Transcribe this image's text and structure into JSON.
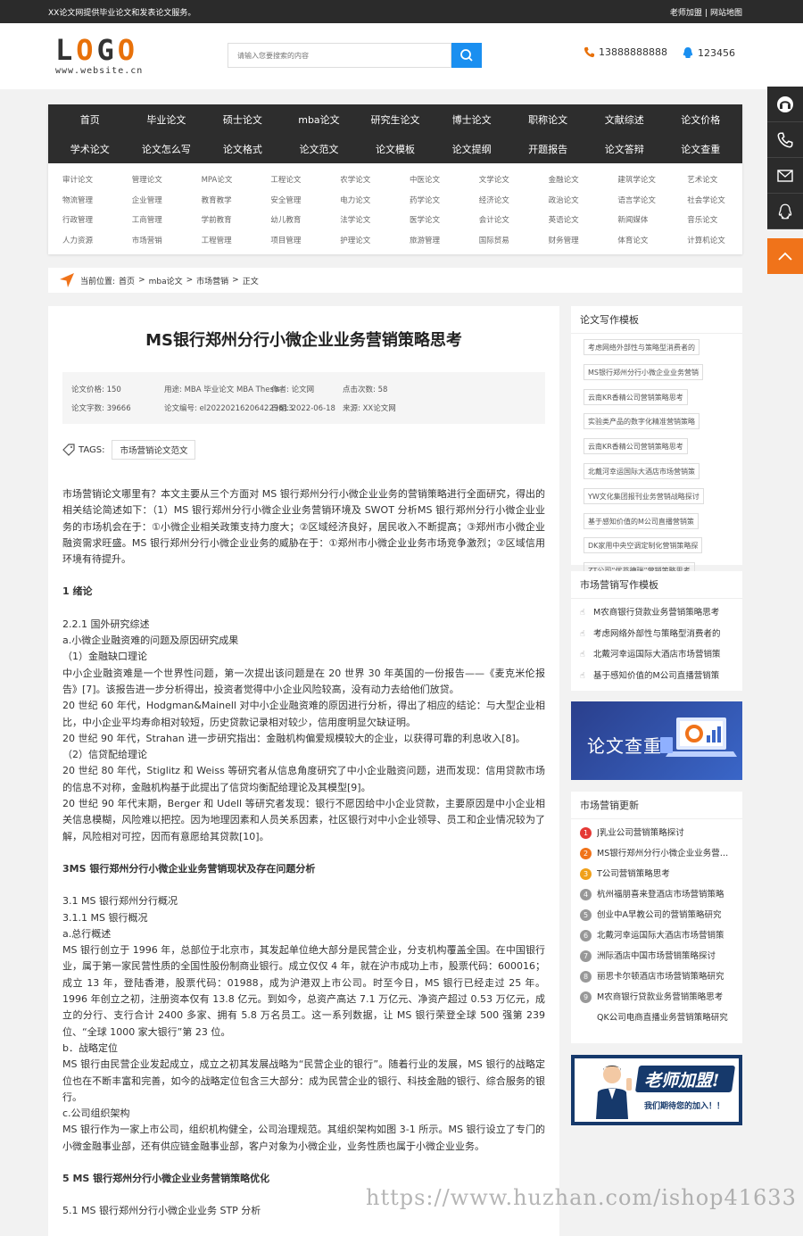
{
  "topbar": {
    "left": "XX论文网提供毕业论文和发表论文服务。",
    "right1": "老师加盟",
    "sep": "|",
    "right2": "网站地图"
  },
  "logo": {
    "text": "LOGO",
    "site": "www.website.cn"
  },
  "search": {
    "placeholder": "请输入您要搜索的内容"
  },
  "contact": {
    "phone": "13888888888",
    "qq": "123456"
  },
  "nav": {
    "row1": [
      "首页",
      "毕业论文",
      "硕士论文",
      "mba论文",
      "研究生论文",
      "博士论文",
      "职称论文",
      "文献综述",
      "论文价格"
    ],
    "row2": [
      "学术论文",
      "论文怎么写",
      "论文格式",
      "论文范文",
      "论文模板",
      "论文提纲",
      "开题报告",
      "论文答辩",
      "论文查重"
    ],
    "sub": [
      [
        "审计论文",
        "管理论文",
        "物流管理",
        "企业管理",
        "行政管理",
        "工商管理",
        "人力资源",
        "市场营销"
      ],
      [
        "MPA论文",
        "工程论文",
        "教育教学",
        "安全管理",
        "学前教育",
        "幼儿教育",
        "工程管理",
        "项目管理"
      ],
      [
        "农学论文",
        "中医论文",
        "电力论文",
        "药学论文",
        "法学论文",
        "医学论文",
        "护理论文",
        "旅游管理"
      ],
      [
        "文学论文",
        "金融论文",
        "经济论文",
        "政治论文",
        "会计论文",
        "英语论文",
        "国际贸易",
        "财务管理"
      ],
      [
        "建筑学论文",
        "艺术论文",
        "语言学论文",
        "社会学论文",
        "新闻媒体",
        "音乐论文",
        "体育论文",
        "计算机论文"
      ]
    ]
  },
  "breadcrumb": {
    "label": "当前位置:",
    "home": "首页",
    "cat": "mba论文",
    "sub": "市场营销",
    "cur": "正文",
    "sep": ">"
  },
  "article": {
    "title": "MS银行郑州分行小微企业业务营销策略思考",
    "meta": [
      "论文价格: 150",
      "用途: MBA 毕业论文 MBA Thesis",
      "作者: 论文网",
      "点击次数: 58",
      "论文字数: 39666",
      "论文编号: el202202162064229613",
      "日期: 2022-06-18",
      "来源: XX论文网"
    ],
    "tags_label": "TAGS:",
    "tag": "市场营销论文范文",
    "abstract": "市场营销论文哪里有？本文主要从三个方面对 MS 银行郑州分行小微企业业务的营销策略进行全面研究，得出的相关结论简述如下：（1）MS 银行郑州分行小微企业业务营销环境及 SWOT 分析MS 银行郑州分行小微企业业务的市场机会在于：①小微企业相关政策支持力度大；②区域经济良好，居民收入不断提高；③郑州市小微企业融资需求旺盛。MS 银行郑州分行小微企业业务的威胁在于：①郑州市小微企业业务市场竞争激烈；②区域信用环境有待提升。",
    "h1": "1 绪论",
    "s221": "2.2.1 国外研究综述",
    "sa": "a.小微企业融资难的问题及原因研究成果",
    "s1": "（1）金融缺口理论",
    "p1": "中小企业融资难是一个世界性问题，第一次提出该问题是在 20 世界 30 年英国的一份报告——《麦克米伦报告》[7]。该报告进一步分析得出，投资者觉得中小企业风险较高，没有动力去给他们放贷。",
    "p2": "20 世纪 60 年代，Hodgman&Mainell 对中小企业融资难的原因进行分析，得出了相应的结论：与大型企业相比，中小企业平均寿命相对较短，历史贷款记录相对较少，信用度明显欠缺证明。",
    "p3": "20 世纪 90 年代，Strahan 进一步研究指出：金融机构偏爱规模较大的企业，以获得可靠的利息收入[8]。",
    "s2": "（2）信贷配给理论",
    "p4": "20 世纪 80 年代，Stiglitz 和 Weiss 等研究者从信息角度研究了中小企业融资问题，进而发现：信用贷款市场的信息不对称，金融机构基于此提出了信贷均衡配给理论及其模型[9]。",
    "p5": "20 世纪 90 年代末期，Berger 和 Udell 等研究者发现：银行不愿因给中小企业贷款，主要原因是中小企业相关信息模糊，风险难以把控。因为地理因素和人员关系因素，社区银行对中小企业领导、员工和企业情况较为了解，风险相对可控，因而有意愿给其贷款[10]。",
    "h3": "3MS 银行郑州分行小微企业业务营销现状及存在问题分析",
    "s31": "3.1 MS 银行郑州分行概况",
    "s311": "3.1.1 MS 银行概况",
    "sa2": "a.总行概述",
    "p6": "MS 银行创立于 1996 年，总部位于北京市，其发起单位绝大部分是民营企业，分支机构覆盖全国。在中国银行业，属于第一家民营性质的全国性股份制商业银行。成立仅仅 4 年，就在沪市成功上市，股票代码：600016；成立 13 年，登陆香港，股票代码：01988，成为沪港双上市公司。时至今日，MS 银行已经走过 25 年。1996 年创立之初，注册资本仅有 13.8 亿元。到如今，总资产高达 7.1 万亿元、净资产超过 0.53 万亿元，成立的分行、支行合计 2400 多家、拥有 5.8 万名员工。这一系列数据，让 MS 银行荣登全球 500 强第 239 位、“全球 1000 家大银行”第 23 位。",
    "sb": "b．战略定位",
    "p7": "MS 银行由民营企业发起成立，成立之初其发展战略为“民营企业的银行”。随着行业的发展，MS 银行的战略定位也在不断丰富和完善，如今的战略定位包含三大部分：成为民营企业的银行、科技金融的银行、综合服务的银行。",
    "sc": "c.公司组织架构",
    "p8": "MS 银行作为一家上市公司，组织机构健全，公司治理规范。其组织架构如图 3-1 所示。MS 银行设立了专门的小微金融事业部，还有供应链金融事业部，客户对象为小微企业，业务性质也属于小微企业业务。",
    "h5": "5 MS 银行郑州分行小微企业业务营销策略优化",
    "s51": "5.1 MS 银行郑州分行小微企业业务 STP 分析"
  },
  "side1": {
    "title": "论文写作模板",
    "items": [
      "考虑网络外部性与策略型消费者的",
      "MS银行郑州分行小微企业业务营销",
      "云南KR香精公司营销策略思考",
      "实验类产品的数字化精准营销策略",
      "云南KR香精公司营销策略思考",
      "北戴河幸运国际大酒店市场营销策",
      "YW文化集团报刊业务营销战略探讨",
      "基于感知价值的M公司直播营销策",
      "DK家用中央空调定制化营销策略探",
      "ZT公司“优苔德瑞”营销策略思考"
    ]
  },
  "side2": {
    "title": "市场营销写作模板",
    "items": [
      "M农商银行贷款业务营销策略思考",
      "考虑网络外部性与策略型消费者的",
      "北戴河幸运国际大酒店市场营销策",
      "基于感知价值的M公司直播营销策"
    ]
  },
  "banner1": {
    "text": "论文查重"
  },
  "side3": {
    "title": "市场营销更新",
    "items": [
      "J乳业公司营销策略探讨",
      "MS银行郑州分行小微企业业务营销策略思考",
      "T公司营销策略思考",
      "杭州福朋喜来登酒店市场营销策略",
      "创业中A早教公司的营销策略研究",
      "北戴河幸运国际大酒店市场营销策",
      "洲际酒店中国市场营销策略探讨",
      "丽思卡尔顿酒店市场营销策略研究",
      "M农商银行贷款业务营销策略思考",
      "QK公司电商直播业务营销策略研究"
    ],
    "nums": [
      "1",
      "2",
      "3",
      "4",
      "5",
      "6",
      "7",
      "8",
      "9",
      ""
    ]
  },
  "banner2": {
    "title": "老师加盟!",
    "sub": "我们期待您的加入！！"
  },
  "watermark": "https://www.huzhan.com/ishop41633",
  "colors": {
    "accent": "#1a8ff0",
    "orange": "#f0731a",
    "dark": "#2d2d2d"
  }
}
